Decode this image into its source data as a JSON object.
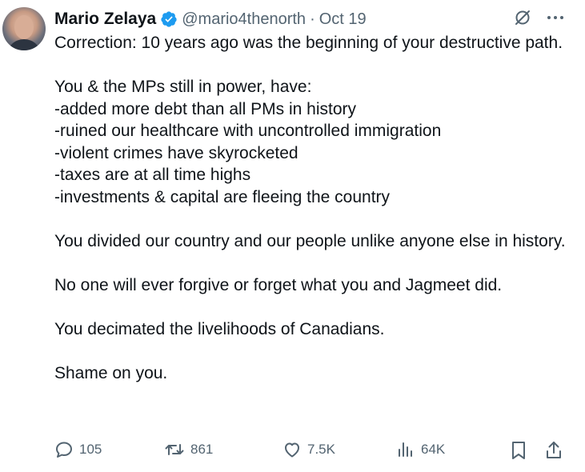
{
  "author": {
    "name": "Mario Zelaya",
    "handle": "@mario4thenorth",
    "separator": "·",
    "date": "Oct 19",
    "verified_color": "#1d9bf0"
  },
  "tweet": {
    "text": "Correction: 10 years ago was the beginning of your destructive path.\n\nYou & the MPs still in power, have:\n-added more debt than all PMs in history\n-ruined our healthcare with uncontrolled immigration\n-violent crimes have skyrocketed\n-taxes are at all time highs\n-investments & capital are fleeing the country\n\nYou divided our country and our people unlike anyone else in history.\n\nNo one will ever forgive or forget what you and Jagmeet did.\n\nYou decimated the livelihoods of Canadians.\n\nShame on you."
  },
  "actions": {
    "replies": "105",
    "reposts": "861",
    "likes": "7.5K",
    "views": "64K"
  },
  "colors": {
    "text": "#0f1419",
    "secondary": "#536471",
    "accent": "#1d9bf0"
  },
  "icons": [
    "grok-icon",
    "more-icon",
    "reply-icon",
    "repost-icon",
    "like-icon",
    "views-icon",
    "bookmark-icon",
    "share-icon",
    "verified-badge-icon"
  ]
}
